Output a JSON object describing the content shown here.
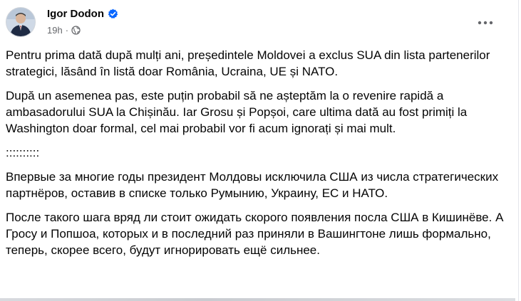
{
  "post": {
    "author": "Igor Dodon",
    "timestamp": "19h",
    "paragraphs": [
      "Pentru prima dată după mulți ani, președintele Moldovei a exclus SUA din lista partenerilor strategici, lăsând în listă doar România, Ucraina, UE și NATO.",
      "După un asemenea pas, este puțin probabil să ne așteptăm la o revenire rapidă a ambasadorului SUA la Chișinău. Iar Grosu și Popșoi, care ultima dată au fost primiți la Washington doar formal, cel mai probabil vor fi acum ignorați și mai mult.",
      "::::::::::",
      "Впервые за многие годы президент Молдовы исключила США из числа стратегических партнёров, оставив в списке только Румынию, Украину, ЕС и НАТО.",
      "После такого шага вряд ли стоит ожидать скорого появления посла США в Кишинёве. А Гросу и Попшоа, которых и в последний раз приняли в Вашингтоне лишь формально, теперь, скорее всего, будут игнорировать ещё сильнее."
    ]
  },
  "icons": {
    "verified": "verified-badge-icon",
    "audience": "globe-icon",
    "more": "more-options-icon"
  },
  "colors": {
    "verified_blue": "#0866ff",
    "meta_gray": "#65676b",
    "text": "#050505"
  }
}
